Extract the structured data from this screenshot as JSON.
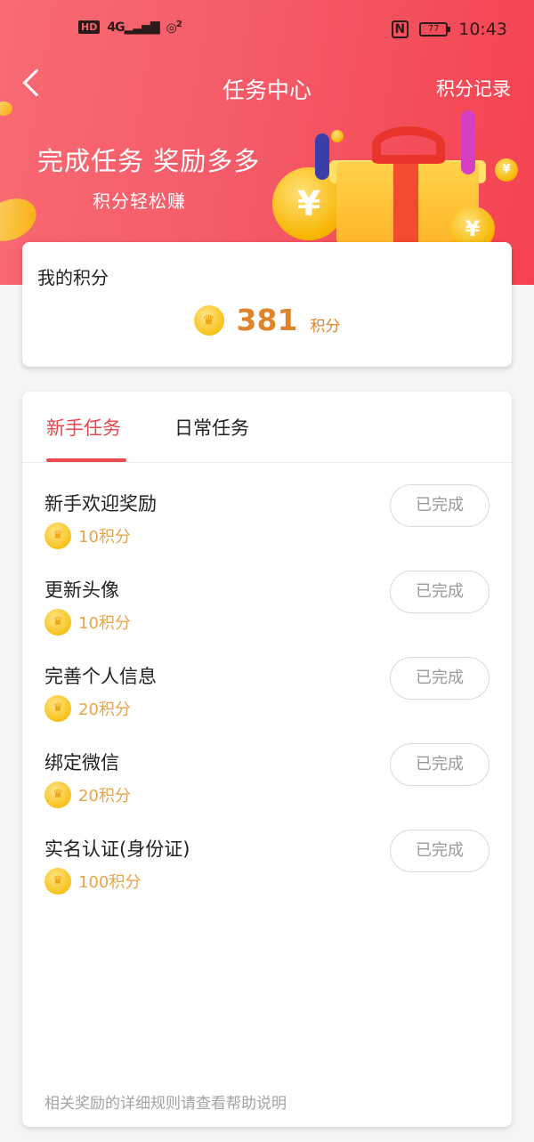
{
  "status_bar": {
    "hd": "HD",
    "signal": "4G",
    "hotspot": "2",
    "nfc": "N",
    "battery": "77",
    "time": "10:43"
  },
  "nav": {
    "title": "任务中心",
    "right_action": "积分记录"
  },
  "hero": {
    "title": "完成任务 奖励多多",
    "subtitle": "积分轻松赚",
    "coin_symbol": "¥"
  },
  "points": {
    "label": "我的积分",
    "value": "381",
    "unit": "积分"
  },
  "tabs": [
    {
      "label": "新手任务",
      "active": true
    },
    {
      "label": "日常任务",
      "active": false
    }
  ],
  "tasks": [
    {
      "name": "新手欢迎奖励",
      "reward": "10积分",
      "status": "已完成"
    },
    {
      "name": "更新头像",
      "reward": "10积分",
      "status": "已完成"
    },
    {
      "name": "完善个人信息",
      "reward": "20积分",
      "status": "已完成"
    },
    {
      "name": "绑定微信",
      "reward": "20积分",
      "status": "已完成"
    },
    {
      "name": "实名认证(身份证)",
      "reward": "100积分",
      "status": "已完成"
    }
  ],
  "footnote": "相关奖励的详细规则请查看帮助说明",
  "colors": {
    "accent": "#e9474e",
    "points": "#e0842a",
    "reward": "#e7a54a"
  }
}
